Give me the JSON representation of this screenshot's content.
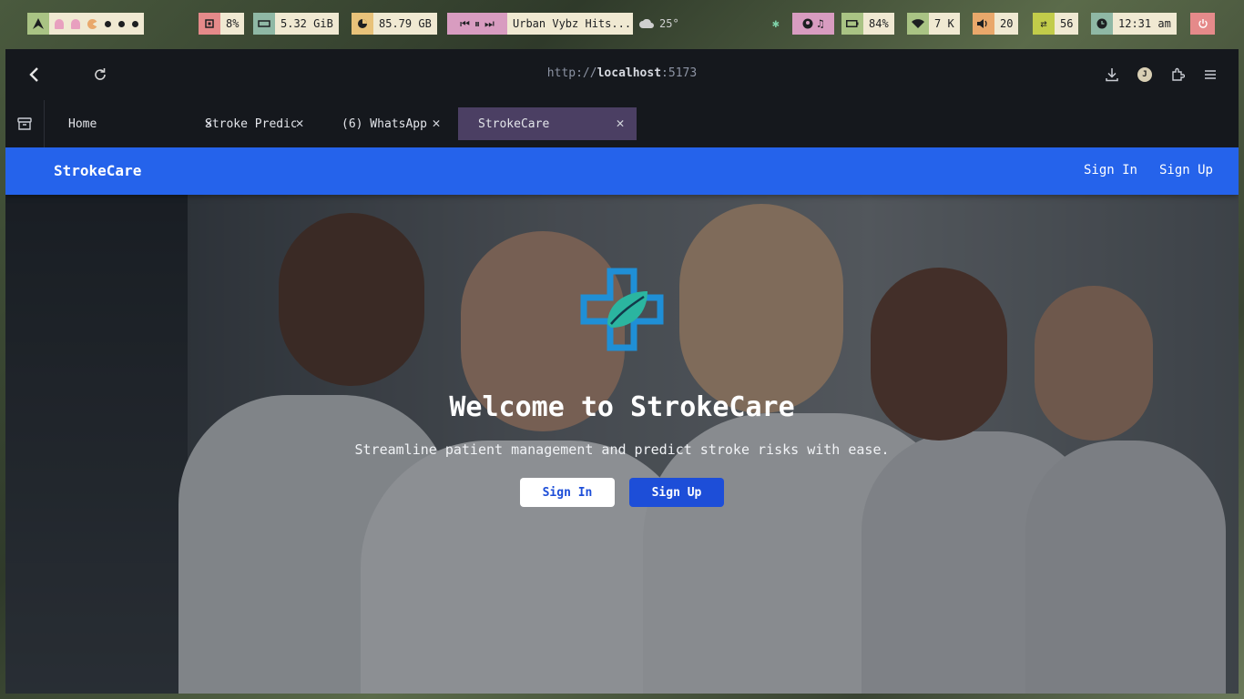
{
  "statusbar": {
    "cpu": "8%",
    "memory": "5.32 GiB",
    "disk": "85.79 GB",
    "media_title": "Urban Vybz Hits...",
    "weather": "25°",
    "battery": "84%",
    "network": "7 K",
    "volume": "20",
    "updates": "56",
    "time": "12:31 am"
  },
  "browser": {
    "url_scheme": "http://",
    "url_host": "localhost",
    "url_port": ":5173",
    "profile_initial": "J",
    "tabs": [
      {
        "label": "Home",
        "active": false
      },
      {
        "label": "Stroke Predic",
        "active": false
      },
      {
        "label": "(6) WhatsApp",
        "active": false
      },
      {
        "label": "StrokeCare",
        "active": true
      }
    ]
  },
  "site": {
    "brand": "StrokeCare",
    "nav_signin": "Sign In",
    "nav_signup": "Sign Up",
    "hero_title": "Welcome to StrokeCare",
    "hero_subtitle": "Streamline patient management and predict stroke risks with ease.",
    "cta_signin": "Sign In",
    "cta_signup": "Sign Up"
  },
  "colors": {
    "navbar": "#2563eb",
    "active_tab": "#4b3f63",
    "cta_primary": "#1d4ed8",
    "logo_blue": "#1f8fd6",
    "logo_teal": "#2bb5a0"
  }
}
